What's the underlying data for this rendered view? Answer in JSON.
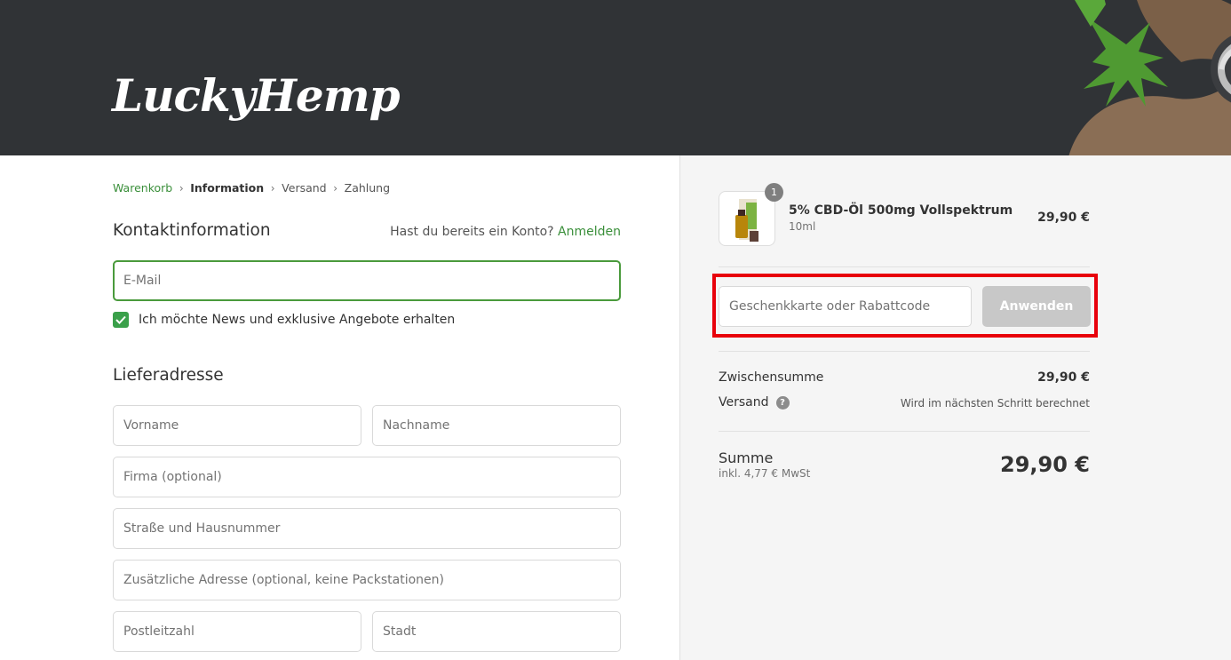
{
  "brand": {
    "logo_text": "LuckyHemp"
  },
  "breadcrumb": {
    "items": [
      "Warenkorb",
      "Information",
      "Versand",
      "Zahlung"
    ]
  },
  "contact": {
    "title": "Kontaktinformation",
    "login_prompt": "Hast du bereits ein Konto?",
    "login_link": "Anmelden",
    "email_placeholder": "E-Mail",
    "newsletter_label": "Ich möchte News und exklusive Angebote erhalten",
    "newsletter_checked": true
  },
  "shipping": {
    "title": "Lieferadresse",
    "first_name": "Vorname",
    "last_name": "Nachname",
    "company": "Firma (optional)",
    "street": "Straße und Hausnummer",
    "address2": "Zusätzliche Adresse (optional, keine Packstationen)",
    "zip": "Postleitzahl",
    "city": "Stadt"
  },
  "cart": {
    "item": {
      "quantity": "1",
      "name": "5% CBD-Öl 500mg Vollspektrum",
      "variant": "10ml",
      "price": "29,90 €"
    },
    "discount_placeholder": "Geschenkkarte oder Rabattcode",
    "apply_label": "Anwenden",
    "subtotal_label": "Zwischensumme",
    "subtotal_value": "29,90 €",
    "shipping_label": "Versand",
    "shipping_value": "Wird im nächsten Schritt berechnet",
    "total_label": "Summe",
    "tax_note": "inkl. 4,77 € MwSt",
    "total_value": "29,90 €"
  },
  "colors": {
    "header_bg": "#303336",
    "accent_green": "#3a8f3a",
    "highlight_red": "#e8000b",
    "button_disabled": "#c8c8c8"
  }
}
